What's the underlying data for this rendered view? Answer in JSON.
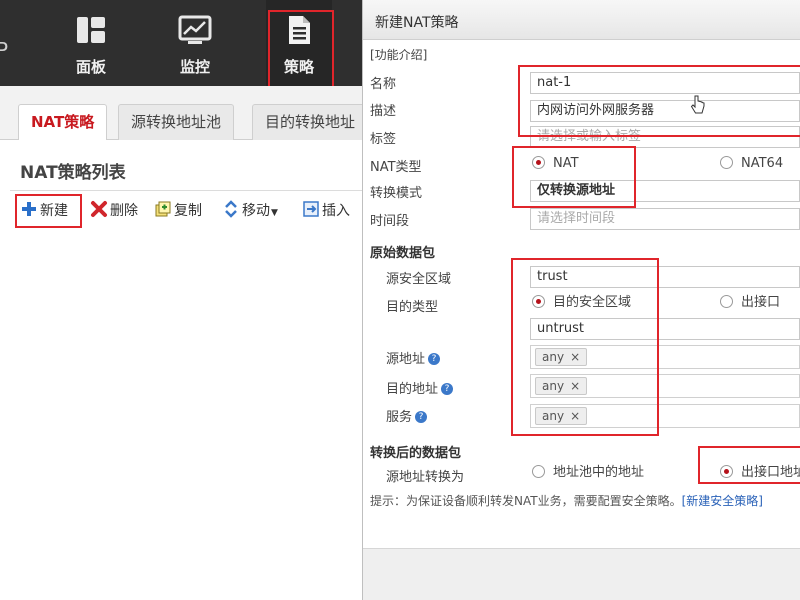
{
  "topnav": {
    "brand_fragment": "P",
    "items": [
      {
        "label": "面板",
        "icon": "dashboard-icon"
      },
      {
        "label": "监控",
        "icon": "monitor-icon"
      },
      {
        "label": "策略",
        "icon": "document-icon",
        "active": true
      }
    ]
  },
  "tabs": [
    {
      "label": "NAT策略",
      "active": true
    },
    {
      "label": "源转换地址池"
    },
    {
      "label": "目的转换地址"
    }
  ],
  "list": {
    "title": "NAT策略列表",
    "toolbar": {
      "new_label": "新建",
      "delete_label": "删除",
      "copy_label": "复制",
      "move_label": "移动",
      "insert_label": "插入"
    }
  },
  "dialog": {
    "title": "新建NAT策略",
    "intro_link": "[功能介绍]",
    "fields": {
      "name": {
        "label": "名称",
        "value": "nat-1"
      },
      "description": {
        "label": "描述",
        "value": "内网访问外网服务器"
      },
      "tag": {
        "label": "标签",
        "placeholder": "请选择或输入标签"
      },
      "nat_type": {
        "label": "NAT类型",
        "options": [
          "NAT",
          "NAT64"
        ],
        "selected": "NAT"
      },
      "mode": {
        "label": "转换模式",
        "value": "仅转换源地址"
      },
      "schedule": {
        "label": "时间段",
        "placeholder": "请选择时间段"
      }
    },
    "original_packet": {
      "section_label": "原始数据包",
      "src_zone": {
        "label": "源安全区域",
        "value": "trust"
      },
      "dst_type": {
        "label": "目的类型",
        "options": [
          "目的安全区域",
          "出接口"
        ],
        "selected": "目的安全区域"
      },
      "dst_zone": {
        "value": "untrust"
      },
      "src_addr": {
        "label": "源地址",
        "tag": "any"
      },
      "dst_addr": {
        "label": "目的地址",
        "tag": "any"
      },
      "service": {
        "label": "服务",
        "tag": "any"
      }
    },
    "translated_packet": {
      "section_label": "转换后的数据包",
      "src_translate": {
        "label": "源地址转换为",
        "options": [
          "地址池中的地址",
          "出接口地址"
        ],
        "selected": "出接口地址"
      }
    },
    "tip": {
      "text": "提示：为保证设备顺利转发NAT业务，需要配置安全策略。",
      "link": "[新建安全策略]"
    }
  },
  "colors": {
    "topbar": "#2f2f2f",
    "highlight": "#e0252b",
    "active_tab_text": "#c8191f",
    "link": "#2a62b8",
    "radio_selected": "#b5121b"
  }
}
